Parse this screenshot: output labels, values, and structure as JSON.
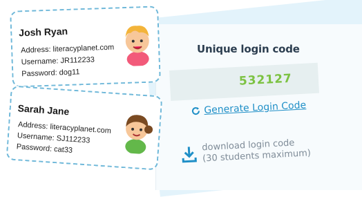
{
  "cards": [
    {
      "name": "Josh Ryan",
      "address": "Address: literacyplanet.com",
      "username": "Username: JR112233",
      "password": "Password: dog11",
      "avatar_icon": "boy-avatar-icon"
    },
    {
      "name": "Sarah Jane",
      "address": "Address: literacyplanet.com",
      "username": "Username: SJ112233",
      "password": "Password: cat33",
      "avatar_icon": "girl-avatar-icon"
    }
  ],
  "panel": {
    "title": "Unique login code",
    "code": "532127",
    "generate_label": "Generate Login Code",
    "download_line1": "download login code",
    "download_line2": "(30 students maximum)"
  },
  "colors": {
    "accent": "#1f8fc7",
    "code_green": "#7cc242",
    "dash_border": "#6fb8d9",
    "panel_bg": "#f7fbfd"
  }
}
